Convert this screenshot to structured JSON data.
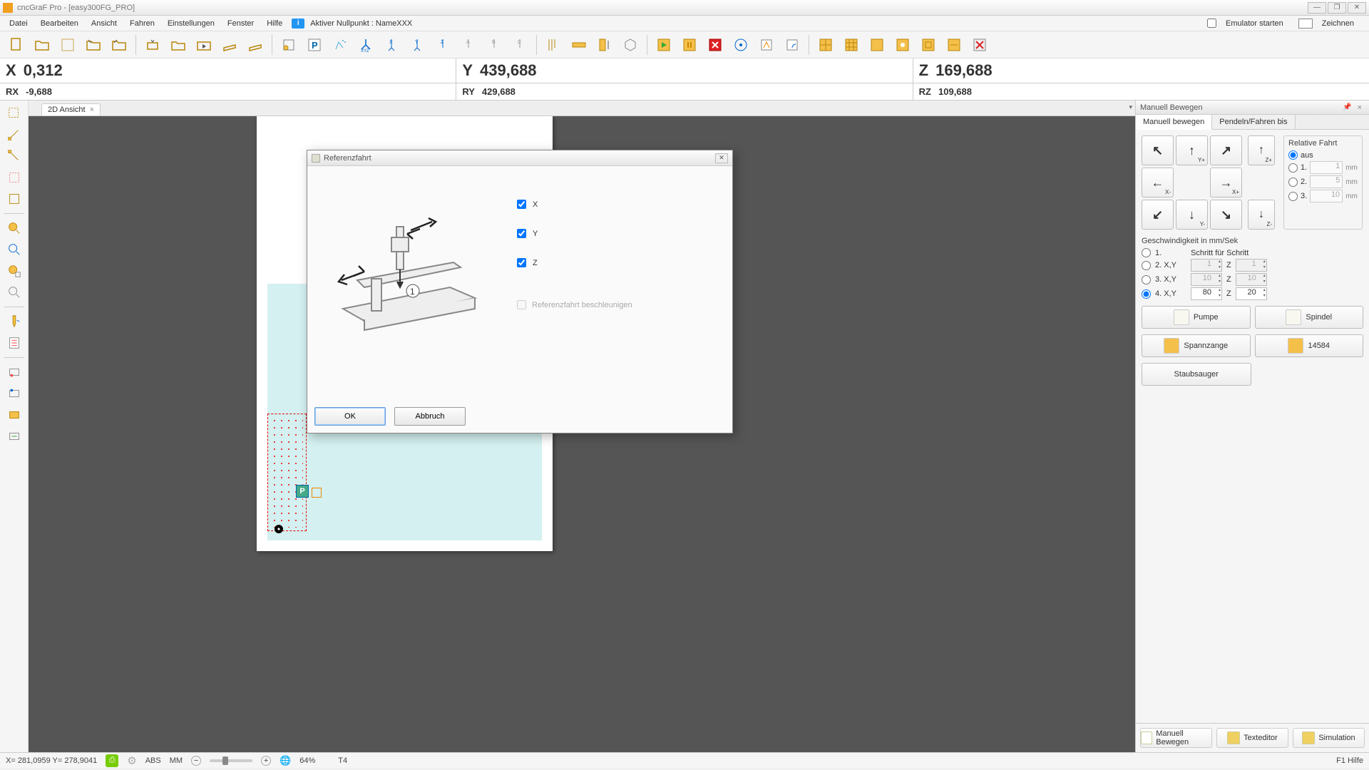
{
  "window": {
    "title": "cncGraF Pro - [easy300FG_PRO]"
  },
  "menu": {
    "items": [
      "Datei",
      "Bearbeiten",
      "Ansicht",
      "Fahren",
      "Einstellungen",
      "Fenster",
      "Hilfe"
    ],
    "nullpunkt": "Aktiver Nullpunkt : NameXXX",
    "emulator": "Emulator starten",
    "zeichnen": "Zeichnen"
  },
  "coords": {
    "X": "0,312",
    "Y": "439,688",
    "Z": "169,688",
    "RX": "-9,688",
    "RY": "429,688",
    "RZ": "109,688"
  },
  "tab": {
    "label": "2D Ansicht"
  },
  "dialog": {
    "title": "Referenzfahrt",
    "axes": {
      "x": "X",
      "y": "Y",
      "z": "Z"
    },
    "beschl": "Referenzfahrt beschleunigen",
    "ok": "OK",
    "cancel": "Abbruch"
  },
  "panel": {
    "title": "Manuell Bewegen",
    "tab1": "Manuell bewegen",
    "tab2": "Pendeln/Fahren bis",
    "jog": {
      "yplus": "Y+",
      "yminus": "Y-",
      "xminus": "X-",
      "xplus": "X+",
      "zplus": "Z+",
      "zminus": "Z-"
    },
    "rel": {
      "title": "Relative Fahrt",
      "aus": "aus",
      "l1": "1.",
      "l2": "2.",
      "l3": "3.",
      "v1": "1",
      "v2": "5",
      "v3": "10",
      "unit": "mm"
    },
    "speed": {
      "title": "Geschwindigkeit in mm/Sek",
      "r1": "1.",
      "r1txt": "Schritt für Schritt",
      "r2": "2. X,Y",
      "r3": "3. X,Y",
      "r4": "4. X,Y",
      "z": "Z",
      "v2xy": "1",
      "v2z": "1",
      "v3xy": "10",
      "v3z": "10",
      "v4xy": "80",
      "v4z": "20"
    },
    "outputs": {
      "pumpe": "Pumpe",
      "spindel": "Spindel",
      "spannzange": "Spannzange",
      "num": "14584",
      "staubsauger": "Staubsauger"
    },
    "bottom": {
      "manuell": "Manuell Bewegen",
      "texteditor": "Texteditor",
      "simulation": "Simulation"
    }
  },
  "status": {
    "coords": "X= 281,0959 Y= 278,9041",
    "abs": "ABS",
    "mm": "MM",
    "zoom": "64%",
    "tool": "T4",
    "help": "F1 Hilfe"
  }
}
